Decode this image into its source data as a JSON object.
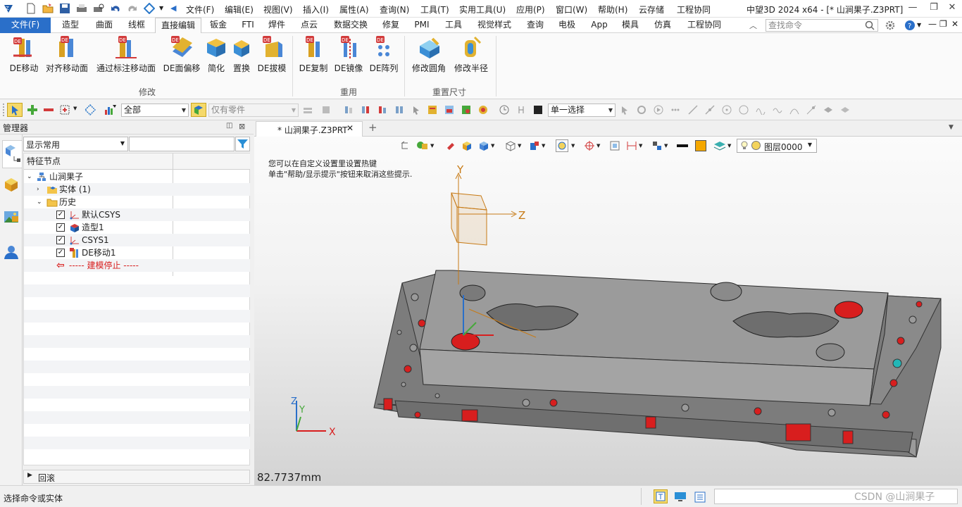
{
  "menubar": {
    "items": [
      "文件(F)",
      "编辑(E)",
      "视图(V)",
      "插入(I)",
      "属性(A)",
      "查询(N)",
      "工具(T)",
      "实用工具(U)",
      "应用(P)",
      "窗口(W)",
      "帮助(H)",
      "云存储",
      "工程协同"
    ],
    "window_title": "中望3D 2024 x64 - [* 山涧果子.Z3PRT]"
  },
  "tabs": {
    "file": "文件(F)",
    "items": [
      "造型",
      "曲面",
      "线框",
      "直接编辑",
      "钣金",
      "FTI",
      "焊件",
      "点云",
      "数据交换",
      "修复",
      "PMI",
      "工具",
      "视觉样式",
      "查询",
      "电极",
      "App",
      "模具",
      "仿真",
      "工程协同"
    ],
    "active": "直接编辑",
    "search_placeholder": "查找命令"
  },
  "ribbon": {
    "buttons": [
      "DE移动",
      "对齐移动面",
      "通过标注移动面",
      "DE面偏移",
      "简化",
      "置换",
      "DE拔模",
      "DE复制",
      "DE镜像",
      "DE阵列",
      "修改圆角",
      "修改半径"
    ],
    "groups": [
      "修改",
      "重用",
      "重置尺寸"
    ]
  },
  "toolbar": {
    "filter_all": "全部",
    "parts_only": "仅有零件",
    "select_mode": "单一选择"
  },
  "manager": {
    "title": "管理器",
    "display_combo": "显示常用",
    "tree_header": "特征节点",
    "tree": {
      "root": "山涧果子",
      "solid": "实体 (1)",
      "history": "历史",
      "items": [
        "默认CSYS",
        "造型1",
        "CSYS1",
        "DE移动1"
      ],
      "stop": "----- 建模停止 -----"
    },
    "footer": "回滚"
  },
  "viewport": {
    "doc_tab": "* 山涧果子.Z3PRT",
    "layer": "图层0000",
    "hint_line1": "您可以在自定义设置里设置热键",
    "hint_line2": "单击\"帮助/显示提示\"按钮来取消这些提示.",
    "measure": "82.7737mm",
    "axis": {
      "x": "X",
      "y": "Y",
      "z": "Z"
    }
  },
  "status": {
    "prompt": "选择命令或实体",
    "watermark": "CSDN @山涧果子"
  },
  "colors": {
    "file_tab": "#2a6fc9",
    "model_body": "#8e8e8e",
    "hole_red": "#d81e1e",
    "hole_cyan": "#22b7b7",
    "accent_orange": "#c77a15"
  }
}
